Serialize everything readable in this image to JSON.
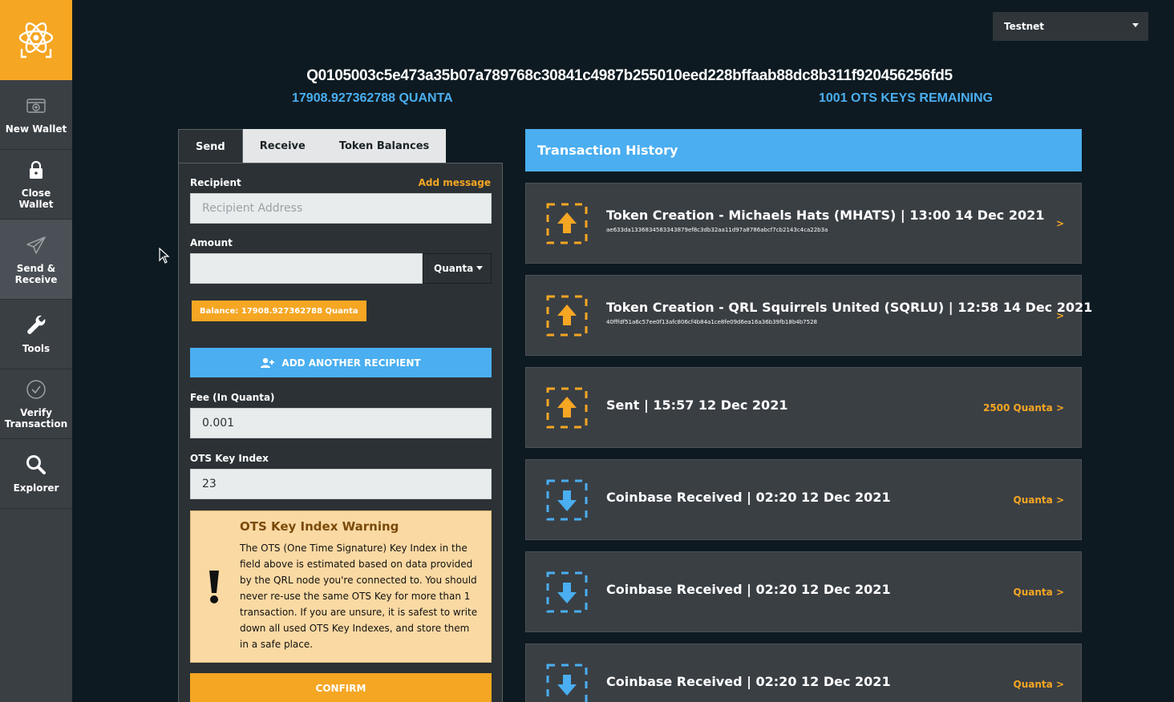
{
  "sidebar": {
    "logo_icon": "qrl-atom-logo-icon",
    "items": [
      {
        "label": "New Wallet",
        "icon": "wallet-add-icon"
      },
      {
        "label": "Close Wallet",
        "icon": "lock-icon"
      },
      {
        "label": "Send & Receive",
        "icon": "paper-plane-icon"
      },
      {
        "label": "Tools",
        "icon": "wrench-icon"
      },
      {
        "label": "Verify Transaction",
        "icon": "check-circle-icon"
      },
      {
        "label": "Explorer",
        "icon": "search-icon"
      }
    ]
  },
  "network": {
    "selected": "Testnet"
  },
  "wallet": {
    "address": "Q0105003c5e473a35b07a789768c30841c4987b255010eed228bffaab88dc8b311f920456256fd5",
    "balance": "17908.927362788 QUANTA",
    "ots_remaining": "1001 OTS KEYS REMAINING"
  },
  "tabs": [
    {
      "label": "Send",
      "active": true
    },
    {
      "label": "Receive",
      "active": false
    },
    {
      "label": "Token Balances",
      "active": false
    }
  ],
  "send_form": {
    "recipient_label": "Recipient",
    "add_message": "Add message",
    "recipient_placeholder": "Recipient Address",
    "amount_label": "Amount",
    "amount_value": "",
    "unit": "Quanta",
    "balance_badge": "Balance: 17908.927362788 Quanta",
    "add_recipient": "ADD ANOTHER RECIPIENT",
    "fee_label": "Fee (In Quanta)",
    "fee_value": "0.001",
    "ots_label": "OTS Key Index",
    "ots_value": "23",
    "warning_title": "OTS Key Index Warning",
    "warning_text": "The OTS (One Time Signature) Key Index in the field above is estimated based on data provided by the QRL node you're connected to. You should never re-use the same OTS Key for more than 1 transaction. If you are unsure, it is safest to write down all used OTS Key Indexes, and store them in a safe place.",
    "confirm": "CONFIRM"
  },
  "history": {
    "title": "Transaction History",
    "items": [
      {
        "direction": "out",
        "title": "Token Creation - Michaels Hats (MHATS) | 13:00 14 Dec 2021",
        "hash": "ae633da1336834583343879ef8c3db32aa11d97a8786abcf7cb2143c4ca22b3a",
        "right": ">"
      },
      {
        "direction": "out",
        "title": "Token Creation - QRL Squirrels United (SQRLU) | 12:58 14 Dec 2021",
        "hash": "40fffdf51a6c57ee0f13afc806cf4b84a1ce8fe09d6ea16a36b39fb18b4b7528",
        "right": ">"
      },
      {
        "direction": "out",
        "title": "Sent | 15:57 12 Dec 2021",
        "hash": "",
        "right": "2500 Quanta >"
      },
      {
        "direction": "in",
        "title": "Coinbase Received | 02:20 12 Dec 2021",
        "hash": "",
        "right": "Quanta >"
      },
      {
        "direction": "in",
        "title": "Coinbase Received | 02:20 12 Dec 2021",
        "hash": "",
        "right": "Quanta >"
      },
      {
        "direction": "in",
        "title": "Coinbase Received | 02:20 12 Dec 2021",
        "hash": "",
        "right": "Quanta >"
      }
    ]
  },
  "colors": {
    "accent_orange": "#f5a623",
    "accent_blue": "#4aaef0",
    "background": "#0e1a21",
    "sidebar": "#3a3f44"
  }
}
